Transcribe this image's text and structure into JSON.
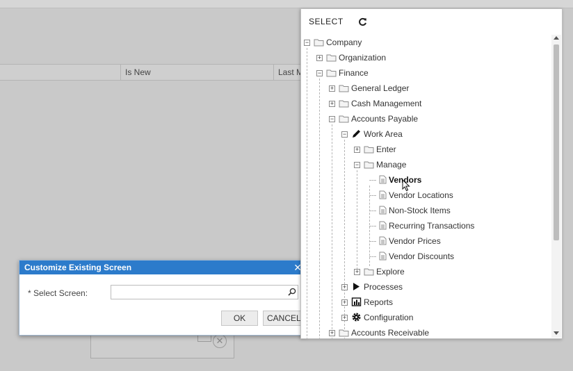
{
  "grid": {
    "col_is_new": "Is New",
    "col_last_modified": "Last M"
  },
  "dialog": {
    "title": "Customize Existing Screen",
    "close_glyph": "✕",
    "select_label": "* Select Screen:",
    "select_value": "",
    "ok_label": "OK",
    "cancel_label": "CANCEL"
  },
  "tree_panel": {
    "title": "SELECT",
    "nodes": {
      "company": "Company",
      "organization": "Organization",
      "finance": "Finance",
      "general_ledger": "General Ledger",
      "cash_management": "Cash Management",
      "accounts_payable": "Accounts Payable",
      "work_area": "Work Area",
      "enter": "Enter",
      "manage": "Manage",
      "vendors": "Vendors",
      "vendor_locations": "Vendor Locations",
      "non_stock_items": "Non-Stock Items",
      "recurring_transactions": "Recurring Transactions",
      "vendor_prices": "Vendor Prices",
      "vendor_discounts": "Vendor Discounts",
      "explore": "Explore",
      "processes": "Processes",
      "reports": "Reports",
      "configuration": "Configuration",
      "accounts_receivable": "Accounts Receivable"
    },
    "expand_glyph": "+",
    "collapse_glyph": "−"
  },
  "colors": {
    "dialog_header": "#2c7bcb",
    "background": "#c9c9c9"
  }
}
